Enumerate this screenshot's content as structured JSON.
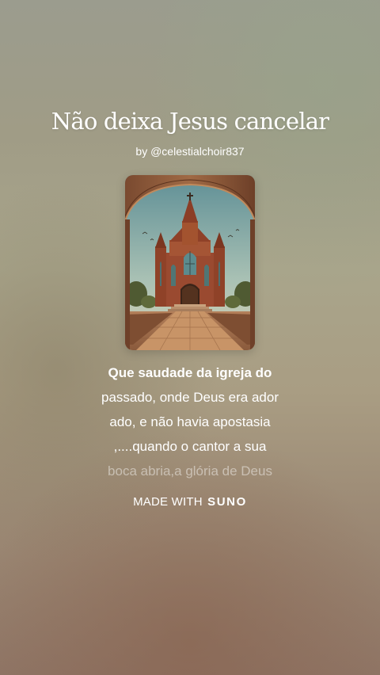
{
  "song": {
    "title": "Não deixa Jesus cancelar",
    "byline": "by @celestialchoir837"
  },
  "cover": {
    "icon": "church-artwork"
  },
  "lyrics": {
    "lines": [
      "Que saudade da igreja do",
      "passado, onde Deus era ador",
      "ado, e não havia apostasia",
      ",....quando o cantor a sua",
      "boca abria,a glória de Deus"
    ]
  },
  "footer": {
    "made_with": "MADE WITH",
    "brand": "SUNO"
  },
  "colors": {
    "text": "#ffffff",
    "faded_text": "rgba(255,255,255,0.45)"
  }
}
